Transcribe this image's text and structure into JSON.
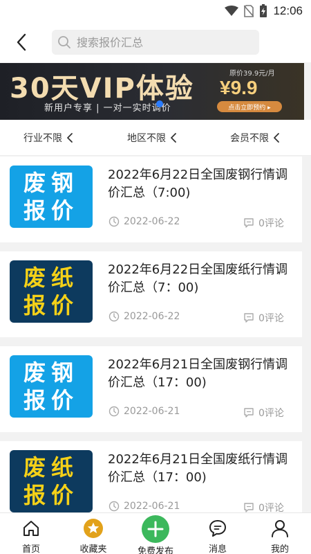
{
  "status_bar": {
    "time": "12:06"
  },
  "header": {
    "search_placeholder": "搜索报价汇总"
  },
  "banner": {
    "title": "30天VIP体验",
    "subtitle": "新用户专享 | 一对一实时调价",
    "original_price": "原价39.9元/月",
    "price": "¥9.9",
    "cta": "点击立即预约 ▸"
  },
  "filters": [
    {
      "label": "行业不限"
    },
    {
      "label": "地区不限"
    },
    {
      "label": "会员不限"
    }
  ],
  "articles": [
    {
      "thumb_line1": "废钢",
      "thumb_line2": "报价",
      "thumb_style": "blue",
      "title": "2022年6月22日全国废钢行情调价汇总（7:00)",
      "date": "2022-06-22",
      "comments": "0评论"
    },
    {
      "thumb_line1": "废纸",
      "thumb_line2": "报价",
      "thumb_style": "navy",
      "title": "2022年6月22日全国废纸行情调价汇总（7：00)",
      "date": "2022-06-22",
      "comments": "0评论"
    },
    {
      "thumb_line1": "废钢",
      "thumb_line2": "报价",
      "thumb_style": "blue",
      "title": "2022年6月21日全国废钢行情调价汇总（17：00)",
      "date": "2022-06-21",
      "comments": "0评论"
    },
    {
      "thumb_line1": "废纸",
      "thumb_line2": "报价",
      "thumb_style": "navy",
      "title": "2022年6月21日全国废纸行情调价汇总（17：00)",
      "date": "2022-06-21",
      "comments": "0评论"
    }
  ],
  "bottom_nav": [
    {
      "label": "首页",
      "icon": "home-icon"
    },
    {
      "label": "收藏夹",
      "icon": "star-icon"
    },
    {
      "label": "免费发布",
      "icon": "plus-icon"
    },
    {
      "label": "消息",
      "icon": "message-icon"
    },
    {
      "label": "我的",
      "icon": "user-icon"
    }
  ],
  "colors": {
    "accent_green": "#3cb85c",
    "star_yellow": "#e2a21b",
    "steel_blue": "#14a2e6",
    "paper_navy": "#0d3a5e",
    "paper_yellow": "#f5d118"
  }
}
